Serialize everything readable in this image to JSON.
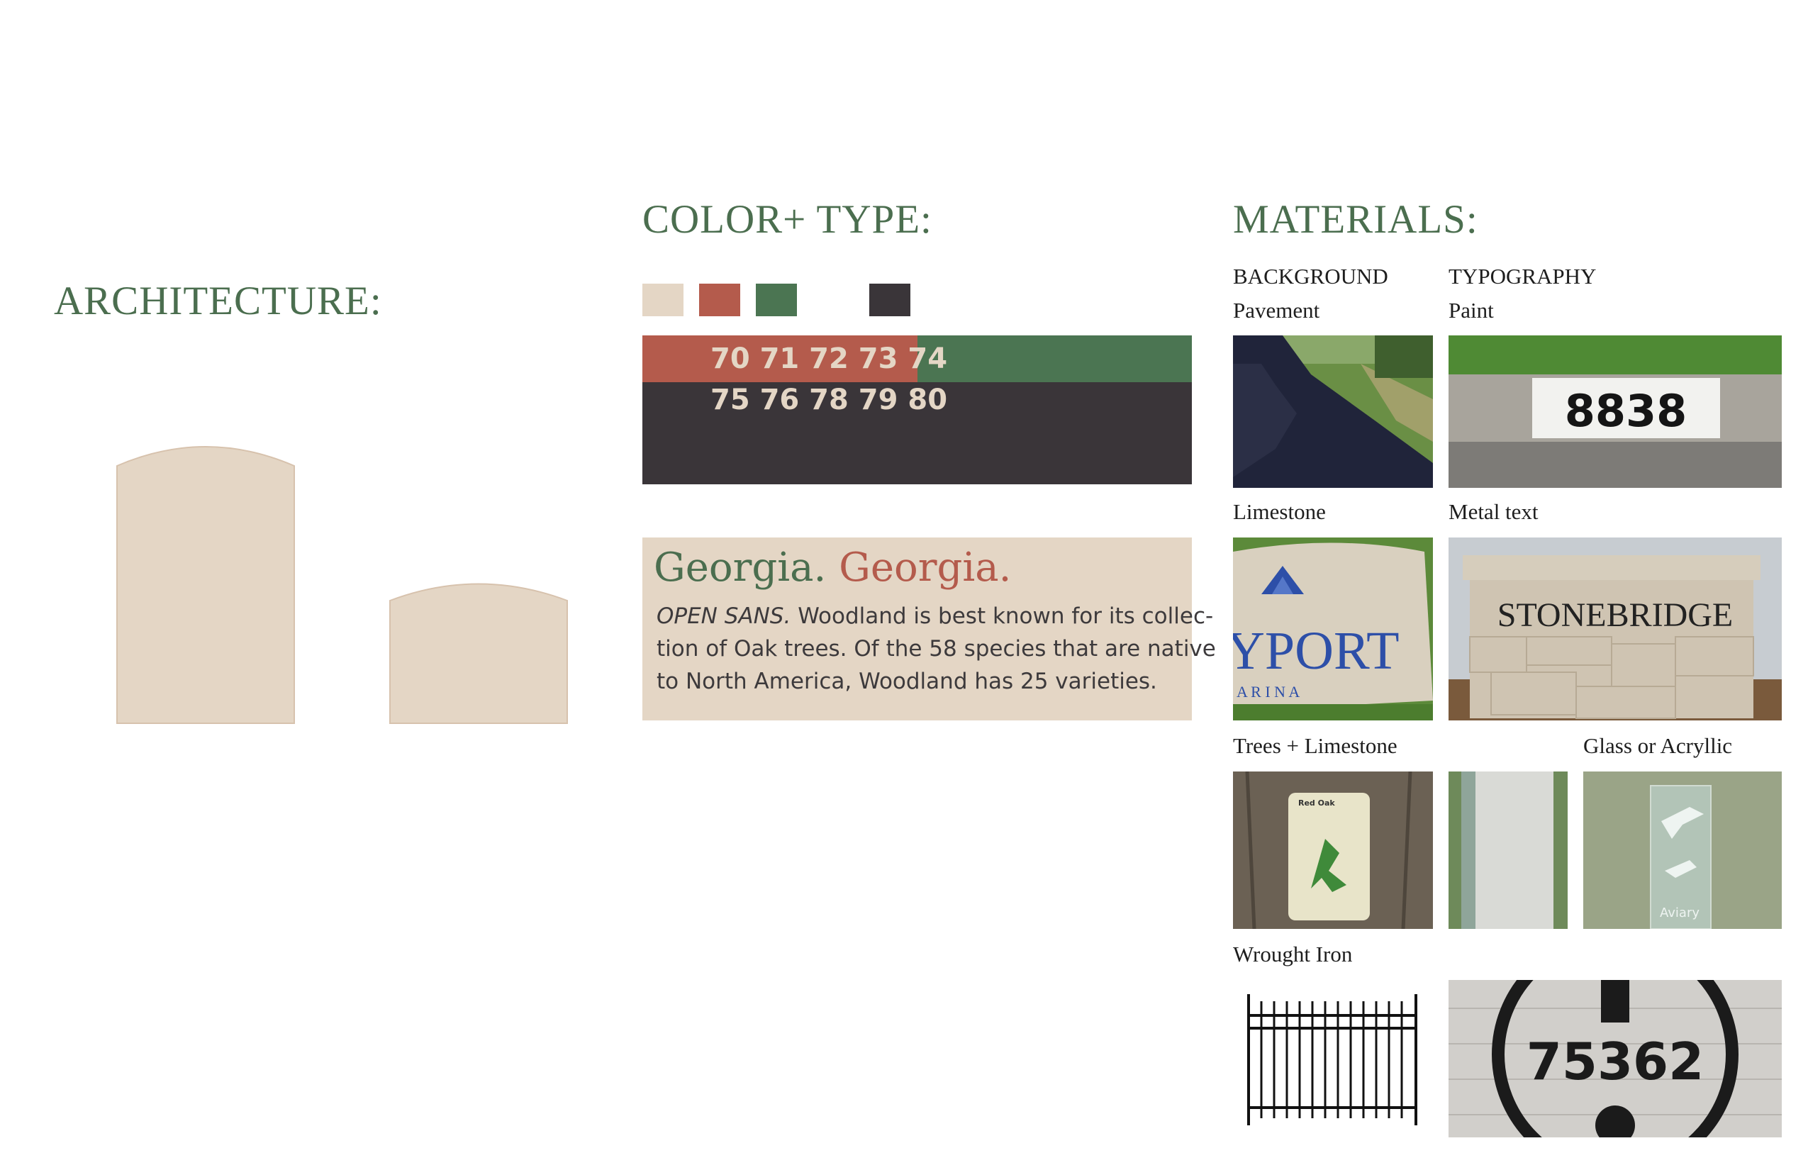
{
  "architecture": {
    "title": "ARCHITECTURE:"
  },
  "color_type": {
    "title": "COLOR+ TYPE:",
    "swatches": [
      {
        "name": "cream",
        "color": "#e4d6c5"
      },
      {
        "name": "red",
        "color": "#b45b4c"
      },
      {
        "name": "green",
        "color": "#4b7552"
      },
      {
        "name": "charcoal",
        "color": "#3a3539"
      }
    ],
    "strip_red_numbers": "70 71 72 73 74",
    "strip_green_numbers": "75 76 78 79 80",
    "type_sample": {
      "heading_green": "Georgia.",
      "heading_red": "Georgia.",
      "body_italic": "OPEN SANS.",
      "body_line1": " Woodland is best known for its collec-",
      "body_line2": "tion of Oak trees. Of the 58 species that are native",
      "body_line3": "to North America, Woodland has 25 varieties."
    }
  },
  "materials": {
    "title": "MATERIALS:",
    "col_background": "BACKGROUND",
    "col_typography": "TYPOGRAPHY",
    "labels": {
      "pavement": "Pavement",
      "paint": "Paint",
      "limestone": "Limestone",
      "metal_text": "Metal text",
      "trees_limestone": "Trees + Limestone",
      "glass_acrylic": "Glass or Acryllic",
      "wrought_iron": "Wrought Iron"
    },
    "photo_text": {
      "paint_number": "8838",
      "limestone_sign": "YPORT",
      "limestone_sub": "A R I N A",
      "metal_sign": "STONEBRIDGE",
      "plaque_title": "Red Oak",
      "glass_text": "Aviary",
      "iron_number": "75362"
    }
  }
}
